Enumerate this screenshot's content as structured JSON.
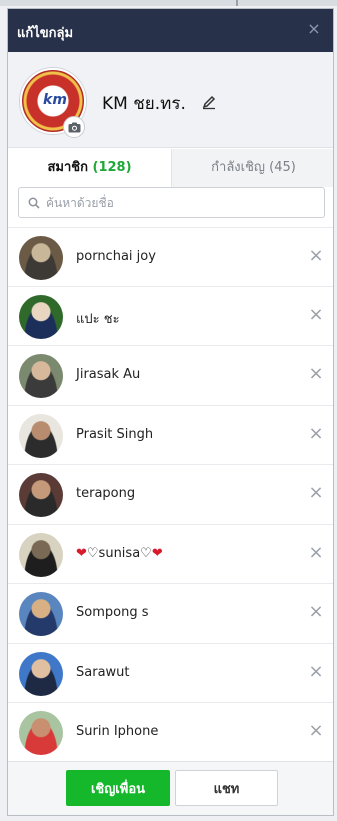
{
  "dialog": {
    "title": "แก้ไขกลุ่ม",
    "close_glyph": "×"
  },
  "group": {
    "name": "KM ชย.ทร.",
    "logo_text": "km",
    "edit_icon": "pencil-icon",
    "camera_icon": "camera-icon"
  },
  "tabs": {
    "members_label": "สมาชิก",
    "members_count": "(128)",
    "invites_label": "กำลังเชิญ (45)"
  },
  "search": {
    "placeholder": "ค้นหาด้วยชื่อ",
    "value": ""
  },
  "members": [
    {
      "name": "pornchai joy",
      "avatar_colors": [
        "#6b5a45",
        "#c9b79a",
        "#3d3a35"
      ]
    },
    {
      "name": "แปะ ชะ",
      "avatar_colors": [
        "#2f6a2b",
        "#e8d6c0",
        "#1c2f5a"
      ]
    },
    {
      "name": "Jirasak Au",
      "avatar_colors": [
        "#7b8a6f",
        "#d8b89a",
        "#3b3b3b"
      ]
    },
    {
      "name": "Prasit Singh",
      "avatar_colors": [
        "#e9e6e0",
        "#b88d6f",
        "#2c2c2c"
      ]
    },
    {
      "name": "terapong",
      "avatar_colors": [
        "#5a3b35",
        "#c49a7a",
        "#2a2a2a"
      ]
    },
    {
      "name": "♡sunisa♡",
      "avatar_colors": [
        "#d8d2c0",
        "#7a6a55",
        "#1e1e1e"
      ]
    },
    {
      "name": "Sompong s",
      "avatar_colors": [
        "#5a86c0",
        "#d8b084",
        "#233a6b"
      ]
    },
    {
      "name": "Sarawut",
      "avatar_colors": [
        "#3f78c8",
        "#e0c0a0",
        "#1e2a44"
      ]
    },
    {
      "name": "Surin Iphone",
      "avatar_colors": [
        "#a9c4a0",
        "#c89070",
        "#d83a3a"
      ]
    }
  ],
  "footer": {
    "invite_label": "เชิญเพื่อน",
    "chat_label": "แชท"
  },
  "colors": {
    "titlebar": "#27314a",
    "accent_green": "#14b82a",
    "count_green": "#1fa839",
    "heart": "#d81b2c"
  }
}
